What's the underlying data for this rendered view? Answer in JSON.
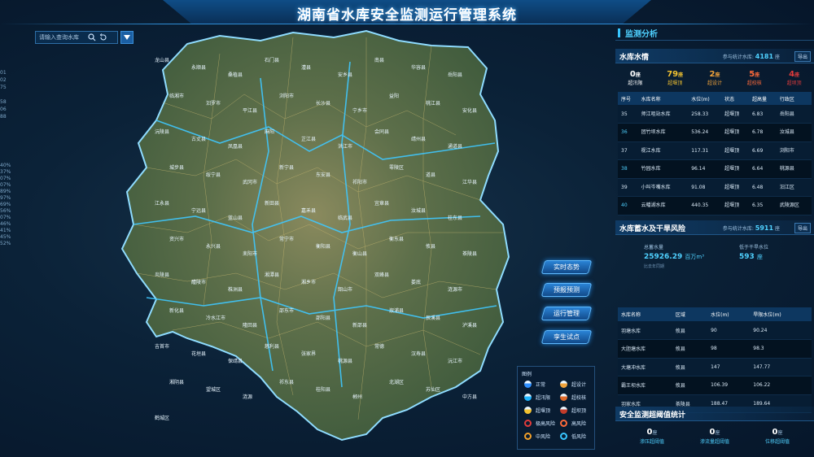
{
  "header": {
    "title": "湖南省水库安全监测运行管理系统"
  },
  "ruler_top": [
    "01",
    "02",
    "75",
    "",
    "58",
    "06",
    "88"
  ],
  "ruler_percent": [
    "40%",
    "37%",
    "07%",
    "07%",
    "89%",
    "97%",
    "69%",
    "56%",
    "07%",
    "46%",
    "41%",
    "45%",
    "52%"
  ],
  "search": {
    "placeholder": "请输入查询水库"
  },
  "icons": {
    "search": "search-icon",
    "reset": "reset-icon",
    "dropdown": "chevron-down-icon"
  },
  "map_buttons": [
    "实时态势",
    "预报预测",
    "运行管理",
    "孪生试点"
  ],
  "map_labels": [
    "龙山县",
    "永顺县",
    "桑植县",
    "石门县",
    "澧县",
    "安乡县",
    "南县",
    "华容县",
    "岳阳县",
    "临湘市",
    "汨罗市",
    "平江县",
    "浏阳市",
    "长沙县",
    "宁乡市",
    "益阳",
    "桃江县",
    "安化县",
    "沅陵县",
    "古丈县",
    "凤凰县",
    "麻阳",
    "芷江县",
    "洪江市",
    "会同县",
    "靖州县",
    "通道县",
    "城步县",
    "绥宁县",
    "武冈市",
    "新宁县",
    "东安县",
    "祁阳市",
    "零陵区",
    "道县",
    "江华县",
    "江永县",
    "宁远县",
    "蓝山县",
    "新田县",
    "嘉禾县",
    "临武县",
    "宜章县",
    "汝城县",
    "桂东县",
    "资兴市",
    "永兴县",
    "耒阳市",
    "常宁市",
    "衡阳县",
    "衡山县",
    "衡东县",
    "攸县",
    "茶陵县",
    "炎陵县",
    "醴陵市",
    "株洲县",
    "湘潭县",
    "湘乡市",
    "韶山市",
    "双峰县",
    "娄底",
    "涟源市",
    "新化县",
    "冷水江市",
    "隆回县",
    "邵东市",
    "邵阳县",
    "新邵县",
    "溆浦县",
    "辰溪县",
    "泸溪县",
    "吉首市",
    "花垣县",
    "保靖县",
    "慈利县",
    "张家界",
    "桃源县",
    "常德",
    "汉寿县",
    "沅江市",
    "湘阴县",
    "望城区",
    "涟源",
    "祁东县",
    "桂阳县",
    "郴州",
    "北湖区",
    "苏仙区",
    "中方县",
    "鹤城区"
  ],
  "legend": {
    "title": "图例",
    "items": [
      {
        "label": "正常",
        "color": "#2f8fff"
      },
      {
        "label": "超设计",
        "color": "#f0a23a"
      },
      {
        "label": "超汛限",
        "color": "#1fb6ff"
      },
      {
        "label": "超校核",
        "color": "#e06a2a"
      },
      {
        "label": "超堰顶",
        "color": "#f2c230"
      },
      {
        "label": "超坝顶",
        "color": "#c23b2a"
      },
      {
        "label": "极高风险",
        "color": "#e23b3b"
      },
      {
        "label": "高风险",
        "color": "#ff6a3a"
      },
      {
        "label": "中风险",
        "color": "#f2a02a"
      },
      {
        "label": "低风险",
        "color": "#38c6ff"
      }
    ]
  },
  "panel": {
    "title": "监测分析",
    "export_label": "导出",
    "water": {
      "title": "水库水情",
      "meta_label": "参与统计水库:",
      "meta_count": "4181",
      "meta_unit": "座",
      "stats": [
        {
          "count": "0",
          "unit": "座",
          "label": "超汛限",
          "color": "#ffffff"
        },
        {
          "count": "79",
          "unit": "座",
          "label": "超堰顶",
          "color": "#f2c230"
        },
        {
          "count": "2",
          "unit": "座",
          "label": "超设计",
          "color": "#f0a23a"
        },
        {
          "count": "5",
          "unit": "座",
          "label": "超校核",
          "color": "#ff6a3a"
        },
        {
          "count": "4",
          "unit": "座",
          "label": "超坝顶",
          "color": "#e23b3b"
        }
      ],
      "columns": [
        "序号",
        "水库名称",
        "水位(m)",
        "状态",
        "超高量",
        "行政区"
      ],
      "rows": [
        [
          "35",
          "师江咀站水库",
          "258.33",
          "超堰顶",
          "6.83",
          "岳阳县"
        ],
        [
          "36",
          "团竹坝水库",
          "536.24",
          "超堰顶",
          "6.78",
          "汝城县"
        ],
        [
          "37",
          "枧江水库",
          "117.31",
          "超堰顶",
          "6.69",
          "浏阳市"
        ],
        [
          "38",
          "竹园水库",
          "96.14",
          "超堰顶",
          "6.64",
          "桃源县"
        ],
        [
          "39",
          "小叫岑嘴水库",
          "91.08",
          "超堰顶",
          "6.48",
          "汨江区"
        ],
        [
          "40",
          "云幡湖水库",
          "440.35",
          "超堰顶",
          "6.35",
          "武陵源区"
        ]
      ]
    },
    "storage": {
      "title": "水库蓄水及干旱风险",
      "meta_label": "参与统计水库:",
      "meta_count": "5911",
      "meta_unit": "座",
      "total_label": "总蓄水量",
      "total_value": "25926.29",
      "total_unit": "百万m³",
      "total_sub": "比去年同期",
      "low_label": "低于干旱水位",
      "low_value": "593",
      "low_unit": "座",
      "columns": [
        "水库名称",
        "区域",
        "水位(m)",
        "旱限水位(m)"
      ],
      "rows": [
        [
          "羽塘水库",
          "攸县",
          "90",
          "90.24"
        ],
        [
          "大胆塘水库",
          "攸县",
          "98",
          "98.3"
        ],
        [
          "大塘冲水库",
          "攸县",
          "147",
          "147.77"
        ],
        [
          "霸王坝水库",
          "攸县",
          "106.39",
          "106.22"
        ],
        [
          "羽家水库",
          "茶陵县",
          "188.47",
          "189.64"
        ]
      ]
    },
    "safety": {
      "title": "安全监测超阈值统计",
      "items": [
        {
          "count": "0",
          "unit": "座",
          "label": "渗压超阈值"
        },
        {
          "count": "0",
          "unit": "座",
          "label": "渗流量超阈值"
        },
        {
          "count": "0",
          "unit": "座",
          "label": "位移超阈值"
        }
      ]
    }
  }
}
